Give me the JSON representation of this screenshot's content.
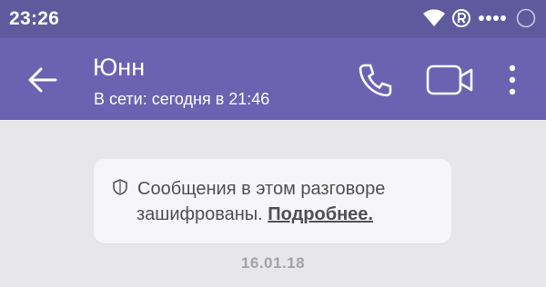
{
  "status_bar": {
    "time": "23:26",
    "icons": [
      "wifi-icon",
      "registered-icon",
      "signal-dots-icon",
      "loading-circle-icon"
    ]
  },
  "header": {
    "contact_name": "Юнн",
    "contact_status": "В сети: сегодня в 21:46",
    "icons": [
      "back-arrow-icon",
      "phone-icon",
      "video-camera-icon",
      "more-vert-icon"
    ]
  },
  "chat": {
    "encryption_notice": {
      "line1": "Сообщения в этом разговоре",
      "line2_prefix": "зашифрованы. ",
      "more_link": "Подробнее.",
      "icon": "shield-icon"
    },
    "date_separator": "16.01.18"
  },
  "colors": {
    "status_bar_bg": "#5f5a9e",
    "header_bg": "#6b62b2",
    "chat_bg": "#e7e7ea",
    "bubble_bg": "#f6f6f8",
    "date_text": "#a3a3a8"
  }
}
